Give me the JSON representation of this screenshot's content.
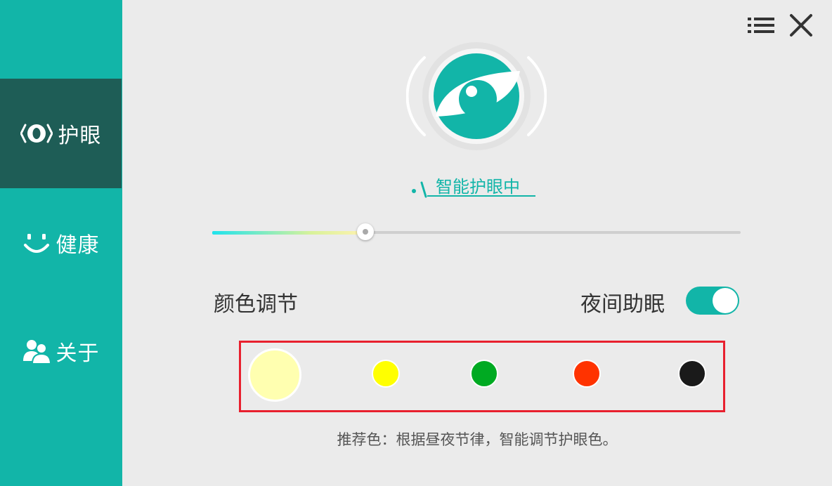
{
  "sidebar": {
    "items": [
      {
        "label": "护眼",
        "icon": "eye-protect-icon",
        "active": true
      },
      {
        "label": "健康",
        "icon": "smile-icon",
        "active": false
      },
      {
        "label": "关于",
        "icon": "users-icon",
        "active": false
      }
    ]
  },
  "header": {
    "menu_icon": "list-menu-icon",
    "close_icon": "close-icon"
  },
  "status": {
    "text": "智能护眼中"
  },
  "slider": {
    "value_percent": 29
  },
  "color_section": {
    "label": "颜色调节"
  },
  "night_mode": {
    "label": "夜间助眠",
    "enabled": true
  },
  "swatches": [
    {
      "color": "#ffffb0",
      "selected": true
    },
    {
      "color": "#ffff00",
      "selected": false
    },
    {
      "color": "#00aa22",
      "selected": false
    },
    {
      "color": "#ff3300",
      "selected": false
    },
    {
      "color": "#1a1a1a",
      "selected": false
    }
  ],
  "hint": {
    "text": "推荐色：根据昼夜节律，智能调节护眼色。"
  },
  "theme": {
    "accent": "#12b5a8",
    "sidebar_active": "#1e5d56",
    "highlight_border": "#e8202e"
  }
}
